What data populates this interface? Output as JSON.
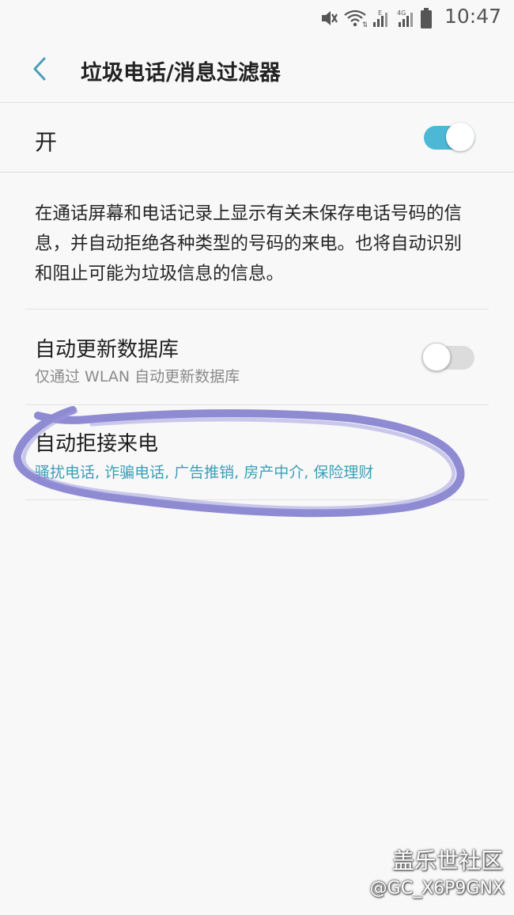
{
  "status_bar": {
    "time": "10:47",
    "icons": [
      "mute-vibrate-icon",
      "wifi-icon",
      "signal-icon",
      "4g-signal-icon",
      "battery-icon"
    ],
    "network_label_e": "E",
    "network_label_4g": "4G"
  },
  "app_bar": {
    "title": "垃圾电话/消息过滤器",
    "back_icon": "chevron-left-icon"
  },
  "master_switch": {
    "label": "开",
    "state": "on"
  },
  "description": "在通话屏幕和电话记录上显示有关未保存电话号码的信息，并自动拒绝各种类型的号码的来电。也将自动识别和阻止可能为垃圾信息的信息。",
  "settings": [
    {
      "title": "自动更新数据库",
      "subtitle": "仅通过 WLAN 自动更新数据库",
      "toggle": "off"
    },
    {
      "title": "自动拒接来电",
      "subtitle": "骚扰电话, 诈骗电话, 广告推销, 房产中介, 保险理财"
    }
  ],
  "watermark": {
    "brand": "盖乐世社区",
    "user": "@GC_X6P9GNX"
  },
  "colors": {
    "accent": "#4db8d6",
    "subtitle_blue": "#3c9fb8",
    "background": "#f8f8f8",
    "highlight_stroke": "#7b78cc"
  }
}
